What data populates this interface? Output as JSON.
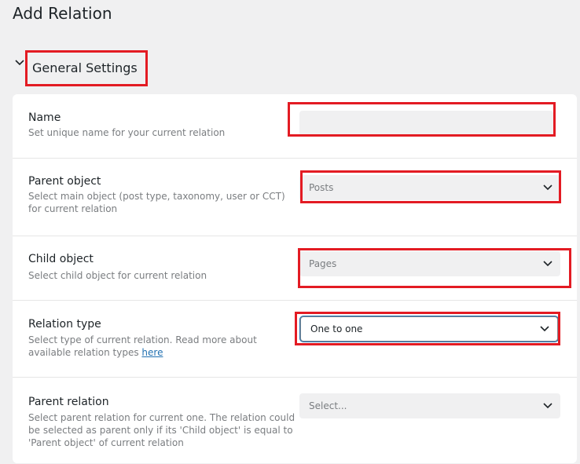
{
  "page": {
    "title": "Add Relation"
  },
  "section": {
    "title": "General Settings"
  },
  "fields": [
    {
      "label": "Name",
      "desc": "Set unique name for your current relation",
      "value": "",
      "placeholder": ""
    },
    {
      "label": "Parent object",
      "desc": "Select main object (post type, taxonomy, user or CCT) for current relation",
      "value": "Posts"
    },
    {
      "label": "Child object",
      "desc": "Select child object for current relation",
      "value": "Pages"
    },
    {
      "label": "Relation type",
      "desc": "Select type of current relation. Read more about available relation types",
      "link": "here",
      "value": "One to one"
    },
    {
      "label": "Parent relation",
      "desc": "Select parent relation for current one. The relation could be selected as parent only if its 'Child object' is equal to 'Parent object' of current relation",
      "value": "Select..."
    }
  ],
  "colors": {
    "highlight": "#e31b23",
    "link": "#2271b1",
    "background": "#f0f0f1"
  },
  "icons": {
    "section_toggle": "chevron-down-icon",
    "select": "chevron-down-icon"
  }
}
